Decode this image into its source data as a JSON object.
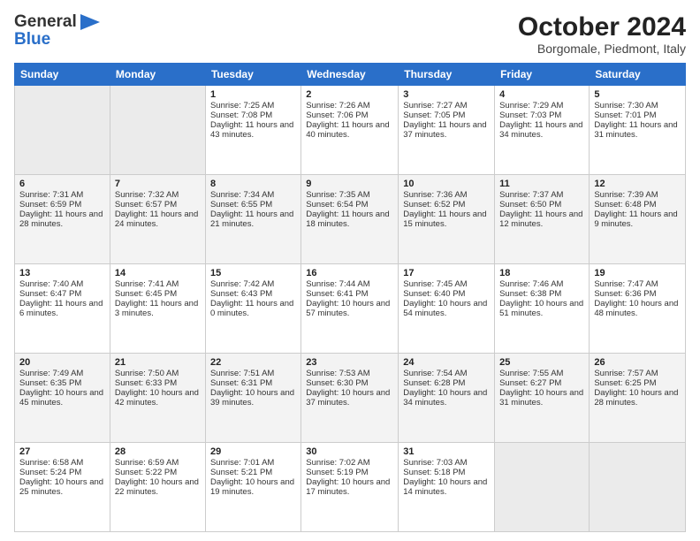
{
  "header": {
    "logo_general": "General",
    "logo_blue": "Blue",
    "month_title": "October 2024",
    "location": "Borgomale, Piedmont, Italy"
  },
  "columns": [
    "Sunday",
    "Monday",
    "Tuesday",
    "Wednesday",
    "Thursday",
    "Friday",
    "Saturday"
  ],
  "weeks": [
    [
      {
        "day": "",
        "sunrise": "",
        "sunset": "",
        "daylight": ""
      },
      {
        "day": "",
        "sunrise": "",
        "sunset": "",
        "daylight": ""
      },
      {
        "day": "1",
        "sunrise": "Sunrise: 7:25 AM",
        "sunset": "Sunset: 7:08 PM",
        "daylight": "Daylight: 11 hours and 43 minutes."
      },
      {
        "day": "2",
        "sunrise": "Sunrise: 7:26 AM",
        "sunset": "Sunset: 7:06 PM",
        "daylight": "Daylight: 11 hours and 40 minutes."
      },
      {
        "day": "3",
        "sunrise": "Sunrise: 7:27 AM",
        "sunset": "Sunset: 7:05 PM",
        "daylight": "Daylight: 11 hours and 37 minutes."
      },
      {
        "day": "4",
        "sunrise": "Sunrise: 7:29 AM",
        "sunset": "Sunset: 7:03 PM",
        "daylight": "Daylight: 11 hours and 34 minutes."
      },
      {
        "day": "5",
        "sunrise": "Sunrise: 7:30 AM",
        "sunset": "Sunset: 7:01 PM",
        "daylight": "Daylight: 11 hours and 31 minutes."
      }
    ],
    [
      {
        "day": "6",
        "sunrise": "Sunrise: 7:31 AM",
        "sunset": "Sunset: 6:59 PM",
        "daylight": "Daylight: 11 hours and 28 minutes."
      },
      {
        "day": "7",
        "sunrise": "Sunrise: 7:32 AM",
        "sunset": "Sunset: 6:57 PM",
        "daylight": "Daylight: 11 hours and 24 minutes."
      },
      {
        "day": "8",
        "sunrise": "Sunrise: 7:34 AM",
        "sunset": "Sunset: 6:55 PM",
        "daylight": "Daylight: 11 hours and 21 minutes."
      },
      {
        "day": "9",
        "sunrise": "Sunrise: 7:35 AM",
        "sunset": "Sunset: 6:54 PM",
        "daylight": "Daylight: 11 hours and 18 minutes."
      },
      {
        "day": "10",
        "sunrise": "Sunrise: 7:36 AM",
        "sunset": "Sunset: 6:52 PM",
        "daylight": "Daylight: 11 hours and 15 minutes."
      },
      {
        "day": "11",
        "sunrise": "Sunrise: 7:37 AM",
        "sunset": "Sunset: 6:50 PM",
        "daylight": "Daylight: 11 hours and 12 minutes."
      },
      {
        "day": "12",
        "sunrise": "Sunrise: 7:39 AM",
        "sunset": "Sunset: 6:48 PM",
        "daylight": "Daylight: 11 hours and 9 minutes."
      }
    ],
    [
      {
        "day": "13",
        "sunrise": "Sunrise: 7:40 AM",
        "sunset": "Sunset: 6:47 PM",
        "daylight": "Daylight: 11 hours and 6 minutes."
      },
      {
        "day": "14",
        "sunrise": "Sunrise: 7:41 AM",
        "sunset": "Sunset: 6:45 PM",
        "daylight": "Daylight: 11 hours and 3 minutes."
      },
      {
        "day": "15",
        "sunrise": "Sunrise: 7:42 AM",
        "sunset": "Sunset: 6:43 PM",
        "daylight": "Daylight: 11 hours and 0 minutes."
      },
      {
        "day": "16",
        "sunrise": "Sunrise: 7:44 AM",
        "sunset": "Sunset: 6:41 PM",
        "daylight": "Daylight: 10 hours and 57 minutes."
      },
      {
        "day": "17",
        "sunrise": "Sunrise: 7:45 AM",
        "sunset": "Sunset: 6:40 PM",
        "daylight": "Daylight: 10 hours and 54 minutes."
      },
      {
        "day": "18",
        "sunrise": "Sunrise: 7:46 AM",
        "sunset": "Sunset: 6:38 PM",
        "daylight": "Daylight: 10 hours and 51 minutes."
      },
      {
        "day": "19",
        "sunrise": "Sunrise: 7:47 AM",
        "sunset": "Sunset: 6:36 PM",
        "daylight": "Daylight: 10 hours and 48 minutes."
      }
    ],
    [
      {
        "day": "20",
        "sunrise": "Sunrise: 7:49 AM",
        "sunset": "Sunset: 6:35 PM",
        "daylight": "Daylight: 10 hours and 45 minutes."
      },
      {
        "day": "21",
        "sunrise": "Sunrise: 7:50 AM",
        "sunset": "Sunset: 6:33 PM",
        "daylight": "Daylight: 10 hours and 42 minutes."
      },
      {
        "day": "22",
        "sunrise": "Sunrise: 7:51 AM",
        "sunset": "Sunset: 6:31 PM",
        "daylight": "Daylight: 10 hours and 39 minutes."
      },
      {
        "day": "23",
        "sunrise": "Sunrise: 7:53 AM",
        "sunset": "Sunset: 6:30 PM",
        "daylight": "Daylight: 10 hours and 37 minutes."
      },
      {
        "day": "24",
        "sunrise": "Sunrise: 7:54 AM",
        "sunset": "Sunset: 6:28 PM",
        "daylight": "Daylight: 10 hours and 34 minutes."
      },
      {
        "day": "25",
        "sunrise": "Sunrise: 7:55 AM",
        "sunset": "Sunset: 6:27 PM",
        "daylight": "Daylight: 10 hours and 31 minutes."
      },
      {
        "day": "26",
        "sunrise": "Sunrise: 7:57 AM",
        "sunset": "Sunset: 6:25 PM",
        "daylight": "Daylight: 10 hours and 28 minutes."
      }
    ],
    [
      {
        "day": "27",
        "sunrise": "Sunrise: 6:58 AM",
        "sunset": "Sunset: 5:24 PM",
        "daylight": "Daylight: 10 hours and 25 minutes."
      },
      {
        "day": "28",
        "sunrise": "Sunrise: 6:59 AM",
        "sunset": "Sunset: 5:22 PM",
        "daylight": "Daylight: 10 hours and 22 minutes."
      },
      {
        "day": "29",
        "sunrise": "Sunrise: 7:01 AM",
        "sunset": "Sunset: 5:21 PM",
        "daylight": "Daylight: 10 hours and 19 minutes."
      },
      {
        "day": "30",
        "sunrise": "Sunrise: 7:02 AM",
        "sunset": "Sunset: 5:19 PM",
        "daylight": "Daylight: 10 hours and 17 minutes."
      },
      {
        "day": "31",
        "sunrise": "Sunrise: 7:03 AM",
        "sunset": "Sunset: 5:18 PM",
        "daylight": "Daylight: 10 hours and 14 minutes."
      },
      {
        "day": "",
        "sunrise": "",
        "sunset": "",
        "daylight": ""
      },
      {
        "day": "",
        "sunrise": "",
        "sunset": "",
        "daylight": ""
      }
    ]
  ]
}
